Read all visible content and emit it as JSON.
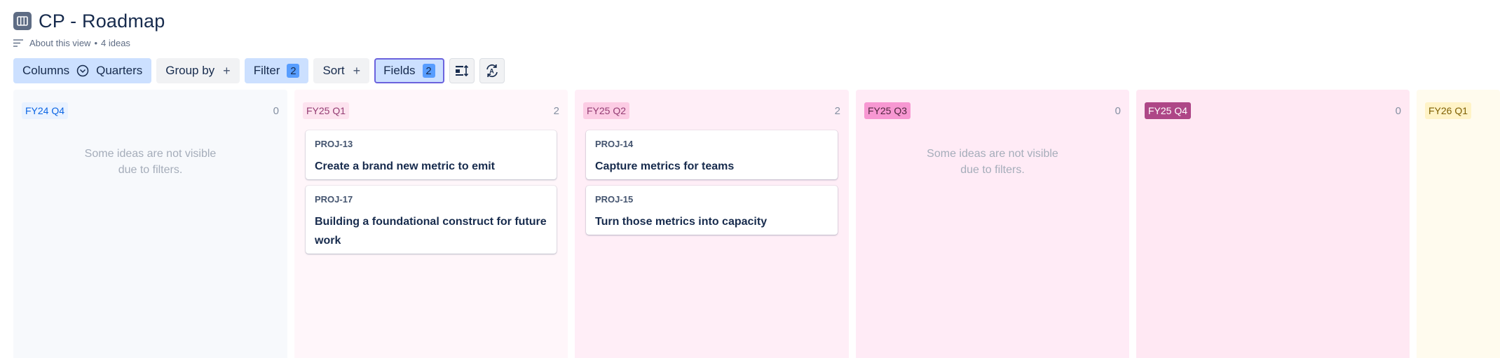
{
  "page": {
    "title": "CP - Roadmap",
    "view_icon": "board-view-icon"
  },
  "subline": {
    "about": "About this view",
    "separator": "•",
    "ideas_count": "4 ideas"
  },
  "toolbar": {
    "columns_label": "Columns",
    "columns_value": "Quarters",
    "group_by_label": "Group by",
    "group_by_plus": "+",
    "filter_label": "Filter",
    "filter_count": "2",
    "sort_label": "Sort",
    "sort_plus": "+",
    "fields_label": "Fields",
    "fields_count": "2",
    "icons": [
      "card-layout-icon",
      "auto-refresh-icon"
    ]
  },
  "colors": {
    "accent_blue": "#cce0ff",
    "badge_blue": "#579dff",
    "fields_border": "#6b63dd"
  },
  "columns": [
    {
      "label": "FY24 Q4",
      "count": "0",
      "hidden_msg": "Some ideas are not visible due to filters.",
      "cards": []
    },
    {
      "label": "FY25 Q1",
      "count": "2",
      "hidden_msg": "",
      "cards": [
        {
          "key": "PROJ-13",
          "summary": "Create a brand new metric to emit"
        },
        {
          "key": "PROJ-17",
          "summary": "Building a foundational construct for future work"
        }
      ]
    },
    {
      "label": "FY25 Q2",
      "count": "2",
      "hidden_msg": "",
      "cards": [
        {
          "key": "PROJ-14",
          "summary": "Capture metrics for teams"
        },
        {
          "key": "PROJ-15",
          "summary": "Turn those metrics into capacity"
        }
      ]
    },
    {
      "label": "FY25 Q3",
      "count": "0",
      "hidden_msg": "Some ideas are not visible due to filters.",
      "cards": []
    },
    {
      "label": "FY25 Q4",
      "count": "0",
      "hidden_msg": "",
      "cards": []
    },
    {
      "label": "FY26 Q1",
      "count": "",
      "hidden_msg": "",
      "cards": []
    }
  ]
}
